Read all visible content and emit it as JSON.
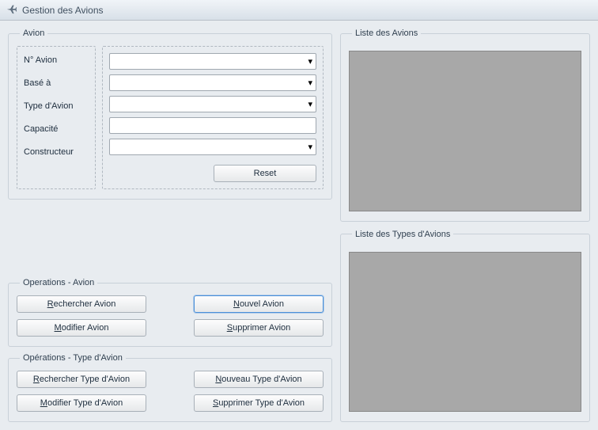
{
  "window": {
    "title": "Gestion des Avions"
  },
  "avion_group": {
    "legend": "Avion",
    "labels": {
      "num": "N° Avion",
      "base": "Basé à",
      "type": "Type d'Avion",
      "capacite": "Capacité",
      "constructeur": "Constructeur"
    },
    "fields": {
      "num": "",
      "base": "",
      "type": "",
      "capacite": "",
      "constructeur": ""
    },
    "reset_label": "Reset"
  },
  "ops_avion": {
    "legend": "Operations - Avion",
    "rechercher": {
      "mnemonic": "R",
      "rest": "echercher Avion"
    },
    "nouvel": {
      "mnemonic": "N",
      "rest": "ouvel Avion"
    },
    "modifier": {
      "mnemonic": "M",
      "rest": "odifier Avion"
    },
    "supprimer": {
      "mnemonic": "S",
      "rest": "upprimer Avion"
    }
  },
  "ops_type": {
    "legend": "Opérations - Type d'Avion",
    "rechercher": {
      "mnemonic": "R",
      "rest": "echercher Type d'Avion"
    },
    "nouveau": {
      "mnemonic": "N",
      "rest": "ouveau Type d'Avion"
    },
    "modifier": {
      "mnemonic": "M",
      "rest": "odifier Type d'Avion"
    },
    "supprimer": {
      "mnemonic": "S",
      "rest": "upprimer Type d'Avion"
    }
  },
  "list_avions": {
    "legend": "Liste des Avions",
    "rows": []
  },
  "list_types": {
    "legend": "Liste des Types d'Avions",
    "rows": []
  }
}
